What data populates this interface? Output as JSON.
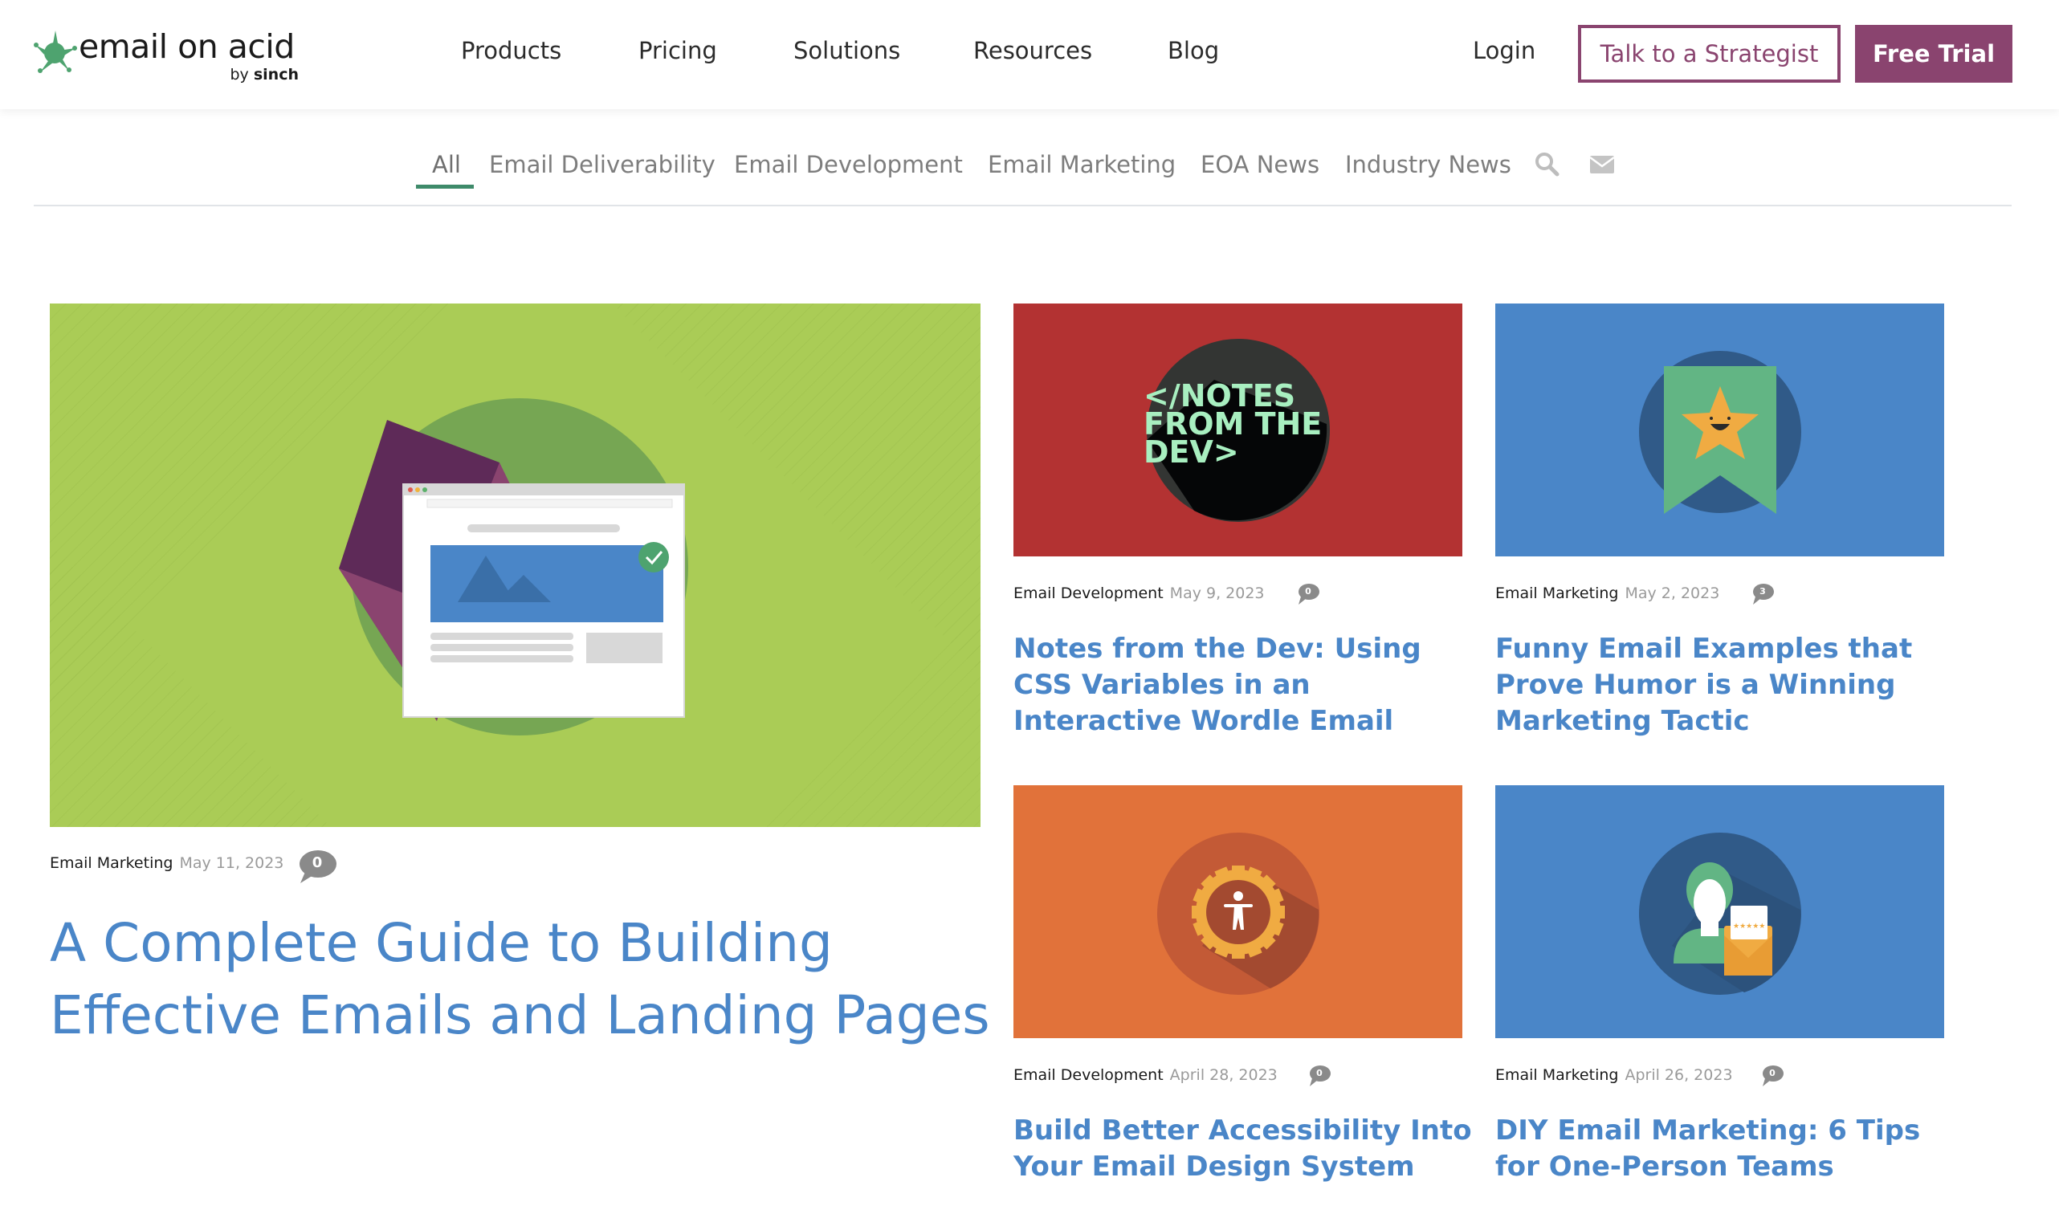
{
  "brand": {
    "name": "email on acid",
    "byline_prefix": "by",
    "byline_brand": "sinch",
    "colors": {
      "accent_purple": "#8a446f",
      "logo_green": "#4ea36f",
      "link_blue": "#4a86c8",
      "underline_green": "#3e8a6a"
    }
  },
  "nav": {
    "items": [
      {
        "label": "Products"
      },
      {
        "label": "Pricing"
      },
      {
        "label": "Solutions"
      },
      {
        "label": "Resources"
      },
      {
        "label": "Blog"
      }
    ],
    "login": "Login",
    "strategist_button": "Talk to a Strategist",
    "trial_button": "Free Trial"
  },
  "filters": {
    "items": [
      {
        "label": "All",
        "active": true
      },
      {
        "label": "Email Deliverability",
        "active": false
      },
      {
        "label": "Email Development",
        "active": false
      },
      {
        "label": "Email Marketing",
        "active": false
      },
      {
        "label": "EOA News",
        "active": false
      },
      {
        "label": "Industry News",
        "active": false
      }
    ],
    "icons": [
      "search-icon",
      "envelope-icon"
    ]
  },
  "featured": {
    "category": "Email Marketing",
    "date": "May 11, 2023",
    "comments": "0",
    "title": "A Complete Guide to Building Effective Emails and Landing Pages",
    "image": "browser-window-envelope-illustration"
  },
  "cards": [
    {
      "category": "Email Development",
      "date": "May 9, 2023",
      "comments": "0",
      "title": "Notes from the Dev: Using CSS Variables in an Interactive Wordle Email",
      "image": "notes-from-the-dev-illustration",
      "image_text": [
        "</NOTES",
        "FROM THE",
        "DEV>"
      ]
    },
    {
      "category": "Email Marketing",
      "date": "May 2, 2023",
      "comments": "3",
      "title": "Funny Email Examples that Prove Humor is a Winning Marketing Tactic",
      "image": "laughing-star-ribbon-illustration"
    },
    {
      "category": "Email Development",
      "date": "April 28, 2023",
      "comments": "0",
      "title": "Build Better Accessibility Into Your Email Design System",
      "image": "accessibility-gear-illustration"
    },
    {
      "category": "Email Marketing",
      "date": "April 26, 2023",
      "comments": "0",
      "title": "DIY Email Marketing: 6 Tips for One-Person Teams",
      "image": "person-with-rated-email-illustration"
    }
  ]
}
